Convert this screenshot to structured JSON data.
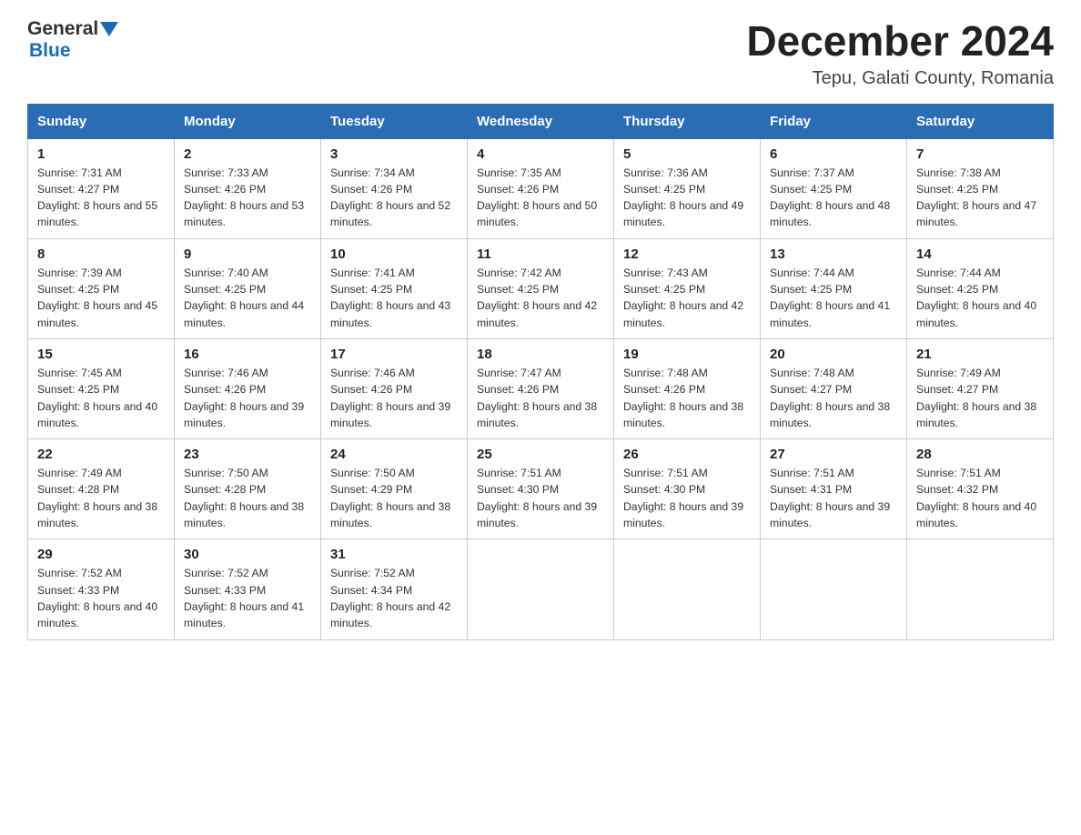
{
  "logo": {
    "text_general": "General",
    "text_blue": "Blue",
    "aria": "GeneralBlue logo"
  },
  "title": "December 2024",
  "subtitle": "Tepu, Galati County, Romania",
  "weekdays": [
    "Sunday",
    "Monday",
    "Tuesday",
    "Wednesday",
    "Thursday",
    "Friday",
    "Saturday"
  ],
  "weeks": [
    [
      {
        "day": "1",
        "sunrise": "7:31 AM",
        "sunset": "4:27 PM",
        "daylight": "8 hours and 55 minutes."
      },
      {
        "day": "2",
        "sunrise": "7:33 AM",
        "sunset": "4:26 PM",
        "daylight": "8 hours and 53 minutes."
      },
      {
        "day": "3",
        "sunrise": "7:34 AM",
        "sunset": "4:26 PM",
        "daylight": "8 hours and 52 minutes."
      },
      {
        "day": "4",
        "sunrise": "7:35 AM",
        "sunset": "4:26 PM",
        "daylight": "8 hours and 50 minutes."
      },
      {
        "day": "5",
        "sunrise": "7:36 AM",
        "sunset": "4:25 PM",
        "daylight": "8 hours and 49 minutes."
      },
      {
        "day": "6",
        "sunrise": "7:37 AM",
        "sunset": "4:25 PM",
        "daylight": "8 hours and 48 minutes."
      },
      {
        "day": "7",
        "sunrise": "7:38 AM",
        "sunset": "4:25 PM",
        "daylight": "8 hours and 47 minutes."
      }
    ],
    [
      {
        "day": "8",
        "sunrise": "7:39 AM",
        "sunset": "4:25 PM",
        "daylight": "8 hours and 45 minutes."
      },
      {
        "day": "9",
        "sunrise": "7:40 AM",
        "sunset": "4:25 PM",
        "daylight": "8 hours and 44 minutes."
      },
      {
        "day": "10",
        "sunrise": "7:41 AM",
        "sunset": "4:25 PM",
        "daylight": "8 hours and 43 minutes."
      },
      {
        "day": "11",
        "sunrise": "7:42 AM",
        "sunset": "4:25 PM",
        "daylight": "8 hours and 42 minutes."
      },
      {
        "day": "12",
        "sunrise": "7:43 AM",
        "sunset": "4:25 PM",
        "daylight": "8 hours and 42 minutes."
      },
      {
        "day": "13",
        "sunrise": "7:44 AM",
        "sunset": "4:25 PM",
        "daylight": "8 hours and 41 minutes."
      },
      {
        "day": "14",
        "sunrise": "7:44 AM",
        "sunset": "4:25 PM",
        "daylight": "8 hours and 40 minutes."
      }
    ],
    [
      {
        "day": "15",
        "sunrise": "7:45 AM",
        "sunset": "4:25 PM",
        "daylight": "8 hours and 40 minutes."
      },
      {
        "day": "16",
        "sunrise": "7:46 AM",
        "sunset": "4:26 PM",
        "daylight": "8 hours and 39 minutes."
      },
      {
        "day": "17",
        "sunrise": "7:46 AM",
        "sunset": "4:26 PM",
        "daylight": "8 hours and 39 minutes."
      },
      {
        "day": "18",
        "sunrise": "7:47 AM",
        "sunset": "4:26 PM",
        "daylight": "8 hours and 38 minutes."
      },
      {
        "day": "19",
        "sunrise": "7:48 AM",
        "sunset": "4:26 PM",
        "daylight": "8 hours and 38 minutes."
      },
      {
        "day": "20",
        "sunrise": "7:48 AM",
        "sunset": "4:27 PM",
        "daylight": "8 hours and 38 minutes."
      },
      {
        "day": "21",
        "sunrise": "7:49 AM",
        "sunset": "4:27 PM",
        "daylight": "8 hours and 38 minutes."
      }
    ],
    [
      {
        "day": "22",
        "sunrise": "7:49 AM",
        "sunset": "4:28 PM",
        "daylight": "8 hours and 38 minutes."
      },
      {
        "day": "23",
        "sunrise": "7:50 AM",
        "sunset": "4:28 PM",
        "daylight": "8 hours and 38 minutes."
      },
      {
        "day": "24",
        "sunrise": "7:50 AM",
        "sunset": "4:29 PM",
        "daylight": "8 hours and 38 minutes."
      },
      {
        "day": "25",
        "sunrise": "7:51 AM",
        "sunset": "4:30 PM",
        "daylight": "8 hours and 39 minutes."
      },
      {
        "day": "26",
        "sunrise": "7:51 AM",
        "sunset": "4:30 PM",
        "daylight": "8 hours and 39 minutes."
      },
      {
        "day": "27",
        "sunrise": "7:51 AM",
        "sunset": "4:31 PM",
        "daylight": "8 hours and 39 minutes."
      },
      {
        "day": "28",
        "sunrise": "7:51 AM",
        "sunset": "4:32 PM",
        "daylight": "8 hours and 40 minutes."
      }
    ],
    [
      {
        "day": "29",
        "sunrise": "7:52 AM",
        "sunset": "4:33 PM",
        "daylight": "8 hours and 40 minutes."
      },
      {
        "day": "30",
        "sunrise": "7:52 AM",
        "sunset": "4:33 PM",
        "daylight": "8 hours and 41 minutes."
      },
      {
        "day": "31",
        "sunrise": "7:52 AM",
        "sunset": "4:34 PM",
        "daylight": "8 hours and 42 minutes."
      },
      null,
      null,
      null,
      null
    ]
  ]
}
